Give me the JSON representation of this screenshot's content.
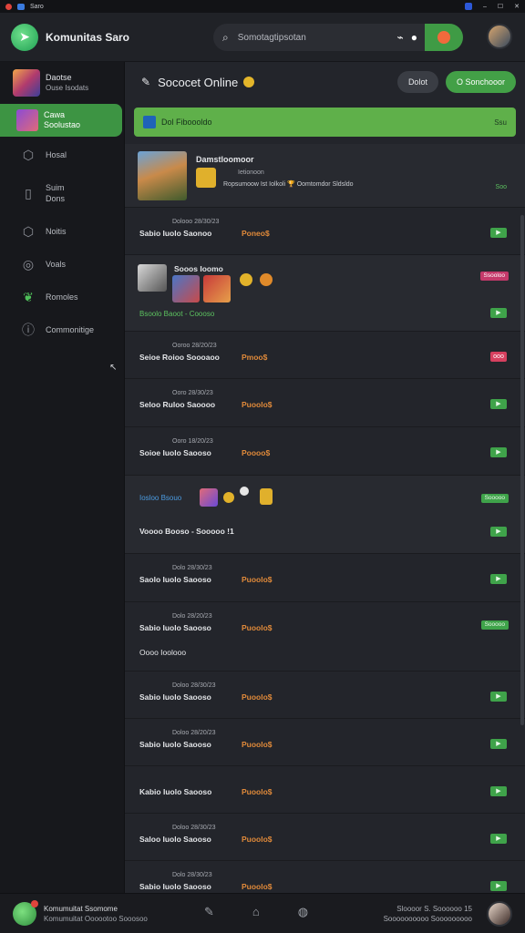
{
  "window": {
    "title": "Saro"
  },
  "app": {
    "title": "Komunitas Saro"
  },
  "search": {
    "placeholder": "Somotagtipsotan"
  },
  "sidebar": {
    "profile": {
      "name": "Daotse",
      "sub": "Ouse Isodats"
    },
    "items": [
      {
        "label": "Cawa",
        "sub": "Soolustao",
        "icon": "game-thumb",
        "active": true
      },
      {
        "label": "Hosal",
        "icon": "box-icon"
      },
      {
        "label": "Suim",
        "sub": "Dons",
        "icon": "door-icon"
      },
      {
        "label": "Noitis",
        "icon": "box-icon"
      },
      {
        "label": "Voals",
        "icon": "circle-icon"
      },
      {
        "label": "Romoles",
        "icon": "leaf-icon"
      },
      {
        "label": "Commonitige",
        "icon": "info-icon"
      }
    ]
  },
  "main": {
    "header_title": "Sococet Online",
    "buttons": {
      "dark": "Dolot",
      "green": "O Sonchooor"
    },
    "banner": {
      "text": "Dol Fiboooldo",
      "right": "Ssu"
    }
  },
  "feed": {
    "featured": {
      "title": "Damstloomoor",
      "line1": "Ietionoon",
      "line2": "Ropsumoow Ist Iolkoli 🏆 Oomtomdor Sldsldo",
      "tag": "Soo"
    },
    "rows": [
      {
        "meta": "Dolooo 28/30/23",
        "name": "Sabio Iuolo Saonoo",
        "amount": "Poneo$",
        "status": "▶"
      },
      {
        "meta": "Ooroo 28/20/23",
        "name": "Seioe Roioo Soooaoo",
        "amount": "Pmoo$",
        "status": "ooo",
        "red": true
      },
      {
        "meta": "Ooro 28/30/23",
        "name": "Seloo Ruloo Saoooo",
        "amount": "Puoolo$",
        "status": "▶"
      },
      {
        "meta": "Ooro 18/20/23",
        "name": "Soioe Iuolo Saooso",
        "amount": "Poooo$",
        "status": "▶"
      },
      {
        "meta": "Dolo 28/30/23",
        "name": "Saolo Iuolo Saooso",
        "amount": "Puoolo$",
        "status": "▶"
      },
      {
        "meta": "Dolo 28/20/23",
        "name": "Sabio Iuolo Saooso",
        "amount": "Puoolo$",
        "status": "▶"
      },
      {
        "meta": "Doloo 28/30/23",
        "name": "Sabio Iuolo Saooso",
        "amount": "Puoolo$",
        "status": "▶"
      },
      {
        "meta": "Doloo 28/20/23",
        "name": "Sabio Iuolo Saooso",
        "amount": "Puoolo$",
        "status": "▶"
      },
      {
        "meta": "",
        "name": "Kabio Iuolo Saooso",
        "amount": "Puoolo$",
        "status": "▶"
      },
      {
        "meta": "Doloo 28/30/23",
        "name": "Saloo Iuolo Saooso",
        "amount": "Puoolo$",
        "status": "▶"
      },
      {
        "meta": "Dolo 28/30/23",
        "name": "Sabio Iuolo Saooso",
        "amount": "Puoolo$",
        "status": "▶"
      }
    ],
    "group1": {
      "title": "Sooos Ioomo",
      "foot": "Bsoolo Baoot - Coooso",
      "tag": "Ssooloo"
    },
    "group2": {
      "prefix": "Iosloo Bsouo",
      "foot": "Voooo Booso - Sooooo !1",
      "tag": "Sooooo"
    },
    "extra_tag": "Sooooo",
    "section_label": "Oooo Ioolooo"
  },
  "bottombar": {
    "title": "Komumuitat Ssomome",
    "sub": "Komumuitat Oooootoo Sooosoo",
    "right_top": "Sloooor S. Soooooo 15",
    "right_bottom": "Soooooooooo Sooooooooo"
  },
  "colors": {
    "accent": "#43a047",
    "amount": "#e08a3a",
    "bg": "#23252b"
  }
}
